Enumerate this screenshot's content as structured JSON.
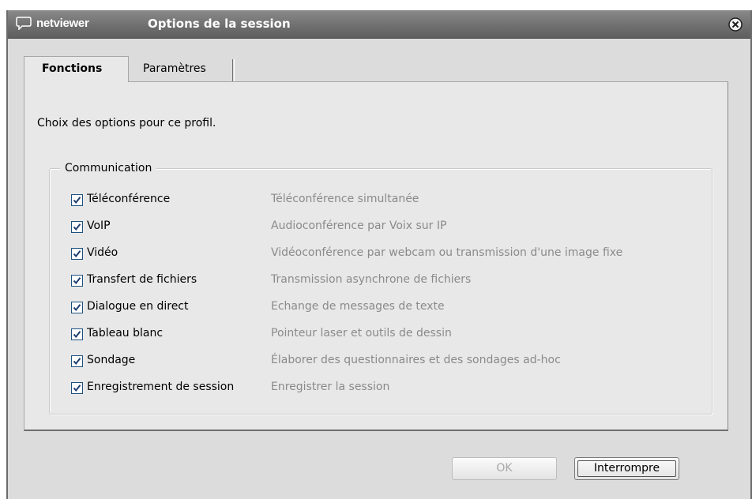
{
  "titlebar": {
    "logo": "netviewer",
    "title": "Options de la session",
    "close_icon": "close-circle-icon"
  },
  "tabs": [
    {
      "label": "Fonctions",
      "active": true
    },
    {
      "label": "Paramètres",
      "active": false
    }
  ],
  "panel": {
    "intro": "Choix des options pour ce profil.",
    "group_title": "Communication",
    "options": [
      {
        "label": "Téléconférence",
        "description": "Téléconférence simultanée",
        "checked": true
      },
      {
        "label": "VoIP",
        "description": "Audioconférence par Voix sur IP",
        "checked": true
      },
      {
        "label": "Vidéo",
        "description": "Vidéoconférence par webcam ou transmission d'une image fixe",
        "checked": true
      },
      {
        "label": "Transfert de fichiers",
        "description": "Transmission asynchrone de fichiers",
        "checked": true
      },
      {
        "label": "Dialogue en direct",
        "description": "Echange de messages de texte",
        "checked": true
      },
      {
        "label": "Tableau blanc",
        "description": "Pointeur laser et outils de dessin",
        "checked": true
      },
      {
        "label": "Sondage",
        "description": "Élaborer des questionnaires et des sondages ad-hoc",
        "checked": true
      },
      {
        "label": "Enregistrement de session",
        "description": "Enregistrer la session",
        "checked": true
      }
    ]
  },
  "buttons": {
    "ok": "OK",
    "cancel": "Interrompre"
  },
  "colors": {
    "titlebar": "#707070",
    "panel": "#e8e8e8",
    "checkbox_border": "#1c5180",
    "description_text": "#8a8a8a"
  }
}
